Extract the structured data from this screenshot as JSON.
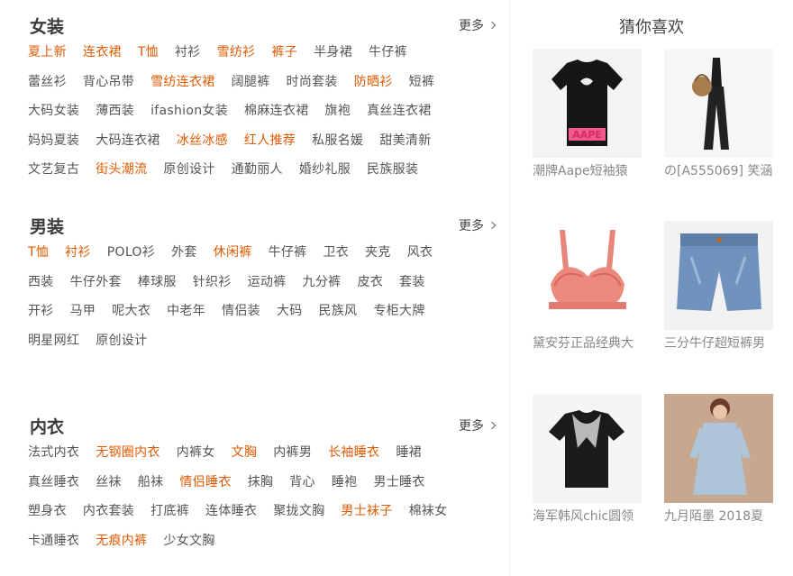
{
  "sections": [
    {
      "title": "女装",
      "more": "更多",
      "rows": [
        [
          {
            "t": "夏上新",
            "hot": true
          },
          {
            "t": "连衣裙",
            "hot": true
          },
          {
            "t": "T恤",
            "hot": true
          },
          {
            "t": "衬衫",
            "hot": false
          },
          {
            "t": "雪纺衫",
            "hot": true
          },
          {
            "t": "裤子",
            "hot": true
          },
          {
            "t": "半身裙",
            "hot": false
          },
          {
            "t": "牛仔裤",
            "hot": false
          }
        ],
        [
          {
            "t": "蕾丝衫",
            "hot": false
          },
          {
            "t": "背心吊带",
            "hot": false
          },
          {
            "t": "雪纺连衣裙",
            "hot": true
          },
          {
            "t": "阔腿裤",
            "hot": false
          },
          {
            "t": "时尚套装",
            "hot": false
          },
          {
            "t": "防晒衫",
            "hot": true
          },
          {
            "t": "短裤",
            "hot": false
          }
        ],
        [
          {
            "t": "大码女装",
            "hot": false
          },
          {
            "t": "薄西装",
            "hot": false
          },
          {
            "t": "ifashion女装",
            "hot": false
          },
          {
            "t": "棉麻连衣裙",
            "hot": false
          },
          {
            "t": "旗袍",
            "hot": false
          },
          {
            "t": "真丝连衣裙",
            "hot": false
          }
        ],
        [
          {
            "t": "妈妈夏装",
            "hot": false
          },
          {
            "t": "大码连衣裙",
            "hot": false
          },
          {
            "t": "冰丝冰感",
            "hot": true
          },
          {
            "t": "红人推荐",
            "hot": true
          },
          {
            "t": "私服名媛",
            "hot": false
          },
          {
            "t": "甜美清新",
            "hot": false
          }
        ],
        [
          {
            "t": "文艺复古",
            "hot": false
          },
          {
            "t": "街头潮流",
            "hot": true
          },
          {
            "t": "原创设计",
            "hot": false
          },
          {
            "t": "通勤丽人",
            "hot": false
          },
          {
            "t": "婚纱礼服",
            "hot": false
          },
          {
            "t": "民族服装",
            "hot": false
          }
        ]
      ]
    },
    {
      "title": "男装",
      "more": "更多",
      "rows": [
        [
          {
            "t": "T恤",
            "hot": true
          },
          {
            "t": "衬衫",
            "hot": true
          },
          {
            "t": "POLO衫",
            "hot": false
          },
          {
            "t": "外套",
            "hot": false
          },
          {
            "t": "休闲裤",
            "hot": true
          },
          {
            "t": "牛仔裤",
            "hot": false
          },
          {
            "t": "卫衣",
            "hot": false
          },
          {
            "t": "夹克",
            "hot": false
          },
          {
            "t": "风衣",
            "hot": false
          }
        ],
        [
          {
            "t": "西装",
            "hot": false
          },
          {
            "t": "牛仔外套",
            "hot": false
          },
          {
            "t": "棒球服",
            "hot": false
          },
          {
            "t": "针织衫",
            "hot": false
          },
          {
            "t": "运动裤",
            "hot": false
          },
          {
            "t": "九分裤",
            "hot": false
          },
          {
            "t": "皮衣",
            "hot": false
          },
          {
            "t": "套装",
            "hot": false
          }
        ],
        [
          {
            "t": "开衫",
            "hot": false
          },
          {
            "t": "马甲",
            "hot": false
          },
          {
            "t": "呢大衣",
            "hot": false
          },
          {
            "t": "中老年",
            "hot": false
          },
          {
            "t": "情侣装",
            "hot": false
          },
          {
            "t": "大码",
            "hot": false
          },
          {
            "t": "民族风",
            "hot": false
          },
          {
            "t": "专柜大牌",
            "hot": false
          }
        ],
        [
          {
            "t": "明星网红",
            "hot": false
          },
          {
            "t": "原创设计",
            "hot": false
          }
        ]
      ]
    },
    {
      "title": "内衣",
      "more": "更多",
      "rows": [
        [
          {
            "t": "法式内衣",
            "hot": false
          },
          {
            "t": "无钢圈内衣",
            "hot": true
          },
          {
            "t": "内裤女",
            "hot": false
          },
          {
            "t": "文胸",
            "hot": true
          },
          {
            "t": "内裤男",
            "hot": false
          },
          {
            "t": "长袖睡衣",
            "hot": true
          },
          {
            "t": "睡裙",
            "hot": false
          }
        ],
        [
          {
            "t": "真丝睡衣",
            "hot": false
          },
          {
            "t": "丝袜",
            "hot": false
          },
          {
            "t": "船袜",
            "hot": false
          },
          {
            "t": "情侣睡衣",
            "hot": true
          },
          {
            "t": "抹胸",
            "hot": false
          },
          {
            "t": "背心",
            "hot": false
          },
          {
            "t": "睡袍",
            "hot": false
          },
          {
            "t": "男士睡衣",
            "hot": false
          }
        ],
        [
          {
            "t": "塑身衣",
            "hot": false
          },
          {
            "t": "内衣套装",
            "hot": false
          },
          {
            "t": "打底裤",
            "hot": false
          },
          {
            "t": "连体睡衣",
            "hot": false
          },
          {
            "t": "聚拢文胸",
            "hot": false
          },
          {
            "t": "男士袜子",
            "hot": true
          },
          {
            "t": "棉袜女",
            "hot": false
          }
        ],
        [
          {
            "t": "卡通睡衣",
            "hot": false
          },
          {
            "t": "无痕内裤",
            "hot": true
          },
          {
            "t": "少女文胸",
            "hot": false
          }
        ]
      ]
    }
  ],
  "recommend": {
    "title": "猜你喜欢",
    "products": [
      {
        "name": "潮牌Aape短袖猿",
        "image": "black-aape-tshirt"
      },
      {
        "name": "の[A555069] 笑涵",
        "image": "black-jumpsuit-with-bag"
      },
      {
        "name": "黛安芬正品经典大",
        "image": "pink-lace-bra"
      },
      {
        "name": "三分牛仔超短裤男",
        "image": "denim-shorts"
      },
      {
        "name": "海军韩风chic圆领",
        "image": "black-tshirt-sailor-collar"
      },
      {
        "name": "九月陌墨 2018夏",
        "image": "blue-linen-dress"
      }
    ]
  },
  "colors": {
    "hot": "#e05a00",
    "normal": "#555555",
    "title": "#3a3a3a",
    "name": "#888888"
  }
}
